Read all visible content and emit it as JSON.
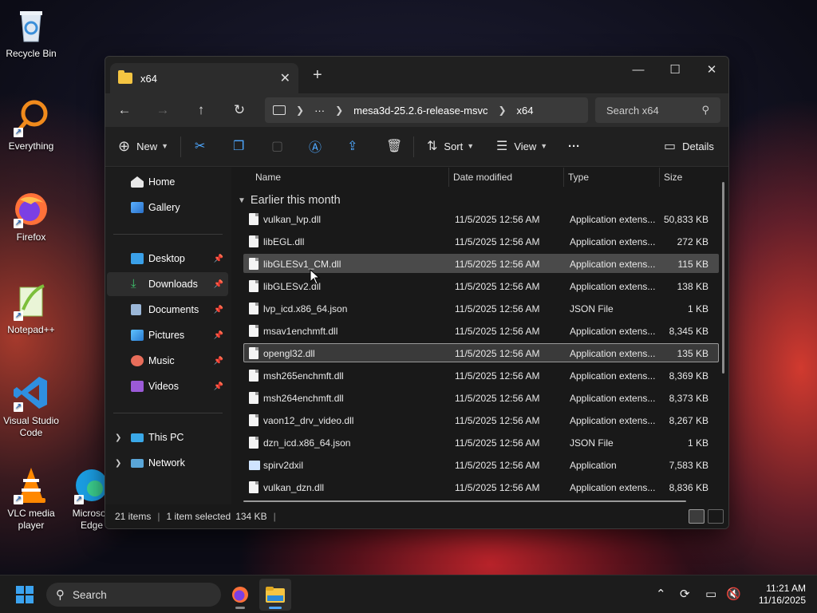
{
  "desktop": {
    "icons": [
      {
        "label": "Recycle Bin",
        "icon": "recycle-bin-icon"
      },
      {
        "label": "Everything",
        "icon": "everything-search-icon"
      },
      {
        "label": "Firefox",
        "icon": "firefox-icon"
      },
      {
        "label": "Notepad++",
        "icon": "notepad-plus-plus-icon"
      },
      {
        "label": "Visual Studio Code",
        "icon": "vscode-icon"
      },
      {
        "label": "VLC media player",
        "icon": "vlc-icon"
      },
      {
        "label": "Microsoft Edge",
        "icon": "edge-icon"
      }
    ]
  },
  "window": {
    "tab_title": "x64",
    "controls": {
      "minimize": "—",
      "maximize": "☐",
      "close": "✕"
    },
    "address": {
      "crumbs": [
        "mesa3d-25.2.6-release-msvc",
        "x64"
      ],
      "ellipsis": "···",
      "search_placeholder": "Search x64"
    },
    "toolbar": {
      "new_label": "New",
      "sort_label": "Sort",
      "view_label": "View",
      "details_label": "Details",
      "more": "···"
    },
    "nav": {
      "home": "Home",
      "gallery": "Gallery",
      "desktop": "Desktop",
      "downloads": "Downloads",
      "documents": "Documents",
      "pictures": "Pictures",
      "music": "Music",
      "videos": "Videos",
      "this_pc": "This PC",
      "network": "Network"
    },
    "columns": {
      "name": "Name",
      "date": "Date modified",
      "type": "Type",
      "size": "Size"
    },
    "group_title": "Earlier this month",
    "files": [
      {
        "name": "vulkan_lvp.dll",
        "date": "11/5/2025 12:56 AM",
        "type": "Application extens...",
        "size": "50,833 KB",
        "kind": "dll"
      },
      {
        "name": "libEGL.dll",
        "date": "11/5/2025 12:56 AM",
        "type": "Application extens...",
        "size": "272 KB",
        "kind": "dll"
      },
      {
        "name": "libGLESv1_CM.dll",
        "date": "11/5/2025 12:56 AM",
        "type": "Application extens...",
        "size": "115 KB",
        "kind": "dll",
        "state": "hover"
      },
      {
        "name": "libGLESv2.dll",
        "date": "11/5/2025 12:56 AM",
        "type": "Application extens...",
        "size": "138 KB",
        "kind": "dll"
      },
      {
        "name": "lvp_icd.x86_64.json",
        "date": "11/5/2025 12:56 AM",
        "type": "JSON File",
        "size": "1 KB",
        "kind": "json"
      },
      {
        "name": "msav1enchmft.dll",
        "date": "11/5/2025 12:56 AM",
        "type": "Application extens...",
        "size": "8,345 KB",
        "kind": "dll"
      },
      {
        "name": "opengl32.dll",
        "date": "11/5/2025 12:56 AM",
        "type": "Application extens...",
        "size": "135 KB",
        "kind": "dll",
        "state": "selected"
      },
      {
        "name": "msh265enchmft.dll",
        "date": "11/5/2025 12:56 AM",
        "type": "Application extens...",
        "size": "8,369 KB",
        "kind": "dll"
      },
      {
        "name": "msh264enchmft.dll",
        "date": "11/5/2025 12:56 AM",
        "type": "Application extens...",
        "size": "8,373 KB",
        "kind": "dll"
      },
      {
        "name": "vaon12_drv_video.dll",
        "date": "11/5/2025 12:56 AM",
        "type": "Application extens...",
        "size": "8,267 KB",
        "kind": "dll"
      },
      {
        "name": "dzn_icd.x86_64.json",
        "date": "11/5/2025 12:56 AM",
        "type": "JSON File",
        "size": "1 KB",
        "kind": "json"
      },
      {
        "name": "spirv2dxil",
        "date": "11/5/2025 12:56 AM",
        "type": "Application",
        "size": "7,583 KB",
        "kind": "app"
      },
      {
        "name": "vulkan_dzn.dll",
        "date": "11/5/2025 12:56 AM",
        "type": "Application extens...",
        "size": "8,836 KB",
        "kind": "dll"
      }
    ],
    "status": {
      "items": "21 items",
      "selected": "1 item selected",
      "size": "134 KB"
    }
  },
  "taskbar": {
    "search_label": "Search",
    "time": "11:21 AM",
    "date": "11/16/2025"
  },
  "colors": {
    "accent": "#4ea8ff",
    "folder": "#f5c542"
  }
}
